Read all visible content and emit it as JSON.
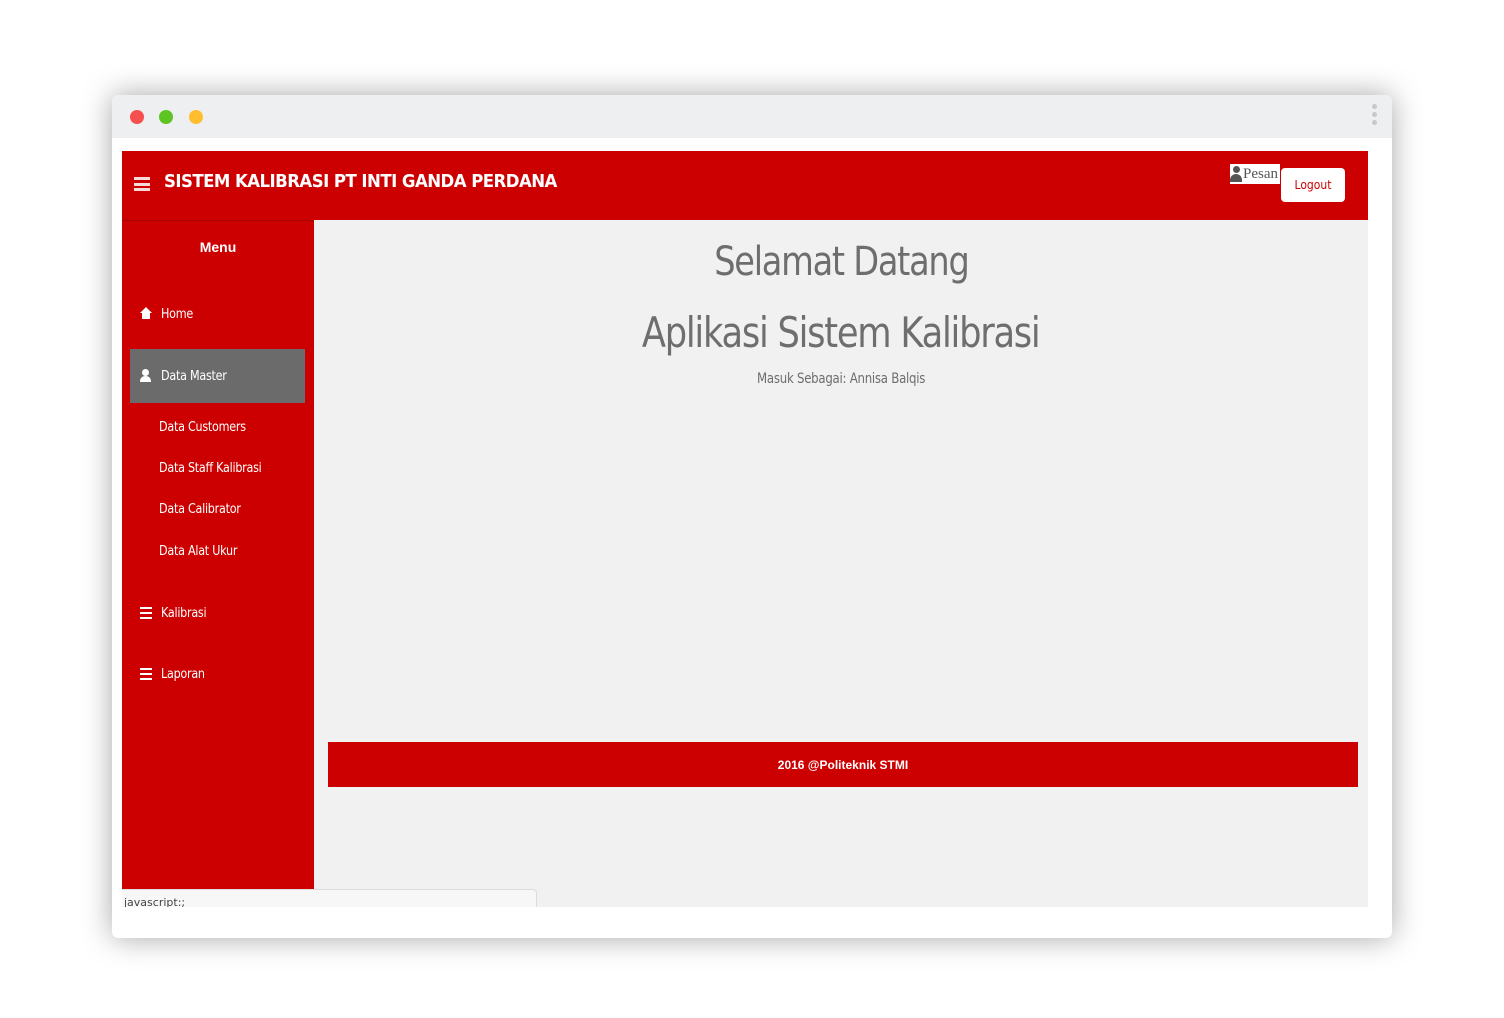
{
  "browser": {
    "window_controls": [
      "close",
      "minimize",
      "zoom"
    ],
    "menu_icon": "kebab-menu-icon"
  },
  "header": {
    "title": "SISTEM KALIBRASI PT INTI GANDA PERDANA",
    "pesan_label": "Pesan",
    "logout_label": "Logout",
    "brand_color": "#cc0000"
  },
  "sidebar": {
    "title": "Menu",
    "items": [
      {
        "label": "Home",
        "icon": "home-icon"
      },
      {
        "label": "Data Master",
        "icon": "user-icon",
        "active": true
      },
      {
        "label": "Kalibrasi",
        "icon": "list-icon"
      },
      {
        "label": "Laporan",
        "icon": "list-icon"
      }
    ],
    "submenu": [
      {
        "label": "Data Customers"
      },
      {
        "label": "Data Staff Kalibrasi"
      },
      {
        "label": "Data Calibrator"
      },
      {
        "label": "Data Alat Ukur"
      }
    ]
  },
  "main": {
    "heading": "Selamat Datang",
    "subheading": "Aplikasi Sistem Kalibrasi",
    "login_info": "Masuk Sebagai: Annisa Balqis"
  },
  "footer": {
    "text": "2016 @Politeknik STMI"
  },
  "statusbar": {
    "text": "javascript:;"
  }
}
